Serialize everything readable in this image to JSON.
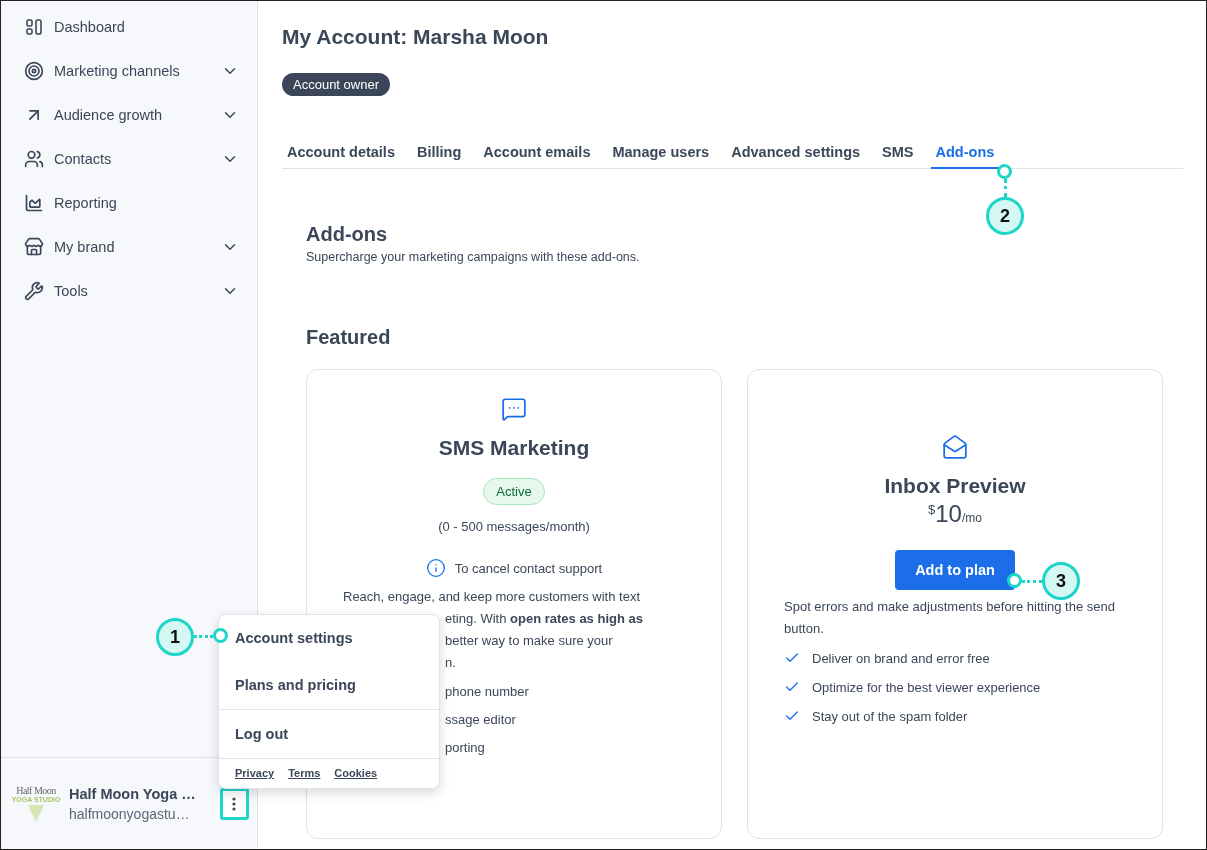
{
  "sidebar": {
    "nav": [
      {
        "label": "Dashboard",
        "expandable": false
      },
      {
        "label": "Marketing channels",
        "expandable": true
      },
      {
        "label": "Audience growth",
        "expandable": true
      },
      {
        "label": "Contacts",
        "expandable": true
      },
      {
        "label": "Reporting",
        "expandable": false
      },
      {
        "label": "My brand",
        "expandable": true
      },
      {
        "label": "Tools",
        "expandable": true
      }
    ],
    "account": {
      "logo_line_1": "Half Moon",
      "logo_line_2": "YOGA STUDIO",
      "name": "Half Moon Yoga …",
      "email": "halfmoonyogastu…"
    }
  },
  "account_menu": {
    "items": [
      "Account settings",
      "Plans and pricing",
      "Log out"
    ],
    "links": [
      "Privacy",
      "Terms",
      "Cookies"
    ]
  },
  "page": {
    "title": "My Account: Marsha Moon",
    "role_badge": "Account owner",
    "tabs": [
      {
        "label": "Account details",
        "selected": false
      },
      {
        "label": "Billing",
        "selected": false
      },
      {
        "label": "Account emails",
        "selected": false
      },
      {
        "label": "Manage users",
        "selected": false
      },
      {
        "label": "Advanced settings",
        "selected": false
      },
      {
        "label": "SMS",
        "selected": false
      },
      {
        "label": "Add-ons",
        "selected": true
      }
    ],
    "section_title": "Add-ons",
    "section_subtitle": "Supercharge your marketing campaigns with these add-ons.",
    "featured_title": "Featured",
    "cards": [
      {
        "kind": "active",
        "title": "SMS Marketing",
        "status": "Active",
        "usage": "(0 - 500 messages/month)",
        "note": "To cancel contact support",
        "description": [
          "Reach, engage, and keep more customers with text",
          "eting. With **open rates as high as**",
          "better way to make sure your",
          "n."
        ],
        "features": [
          "phone number",
          "ssage editor",
          "porting"
        ]
      },
      {
        "kind": "offer",
        "title": "Inbox Preview",
        "currency": "$",
        "amount": "10",
        "period": "/mo",
        "button": "Add to plan",
        "description": [
          "Spot errors and make adjustments before hitting the send button."
        ],
        "features": [
          "Deliver on brand and error free",
          "Optimize for the best viewer experience",
          "Stay out of the spam folder"
        ]
      }
    ]
  },
  "callouts": [
    "1",
    "2",
    "3"
  ]
}
